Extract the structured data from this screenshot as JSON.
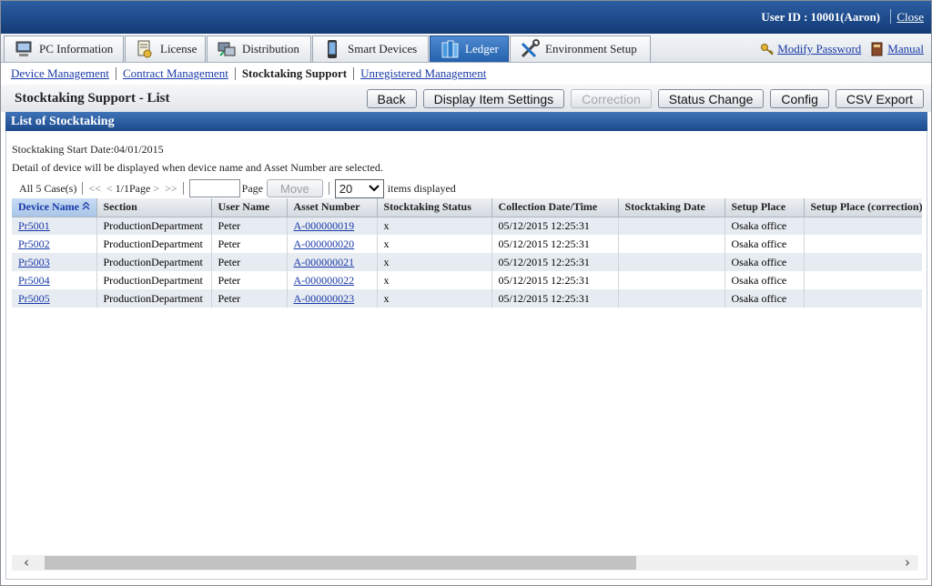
{
  "header": {
    "user_text": "User ID : 10001(Aaron)",
    "close_label": "Close"
  },
  "tabs": [
    {
      "label": "PC Information",
      "icon": "pc-icon"
    },
    {
      "label": "License",
      "icon": "license-icon"
    },
    {
      "label": "Distribution",
      "icon": "distribution-icon"
    },
    {
      "label": "Smart Devices",
      "icon": "smartphone-icon"
    },
    {
      "label": "Ledger",
      "icon": "ledger-icon",
      "active": true
    },
    {
      "label": "Environment Setup",
      "icon": "tools-icon"
    }
  ],
  "links": {
    "modify_password": "Modify Password",
    "manual": "Manual"
  },
  "subnav": {
    "device_management": "Device Management",
    "contract_management": "Contract Management",
    "stocktaking_support": "Stocktaking Support",
    "unregistered_management": "Unregistered Management"
  },
  "page": {
    "title": "Stocktaking Support - List",
    "section_title": "List of Stocktaking"
  },
  "toolbar": {
    "back": "Back",
    "display_item_settings": "Display Item Settings",
    "correction": "Correction",
    "status_change": "Status Change",
    "config": "Config",
    "csv_export": "CSV Export"
  },
  "info": {
    "start_date": "Stocktaking Start Date:04/01/2015",
    "detail_note": "Detail of device will be displayed when device name and Asset Number are selected."
  },
  "paging": {
    "case_count": "All 5 Case(s)",
    "first": "<<",
    "prev": "<",
    "page_indicator": "1/1Page",
    "next": ">",
    "last": ">>",
    "page_input_value": "",
    "page_label": "Page",
    "move_label": "Move",
    "items_per_page": "20",
    "items_label": "items displayed"
  },
  "table": {
    "columns": [
      "Device Name",
      "Section",
      "User Name",
      "Asset Number",
      "Stocktaking Status",
      "Collection Date/Time",
      "Stocktaking Date",
      "Setup Place",
      "Setup Place (correction)"
    ],
    "rows": [
      [
        "Pr5001",
        "ProductionDepartment",
        "Peter",
        "A-000000019",
        "x",
        "05/12/2015 12:25:31",
        "",
        "Osaka office",
        ""
      ],
      [
        "Pr5002",
        "ProductionDepartment",
        "Peter",
        "A-000000020",
        "x",
        "05/12/2015 12:25:31",
        "",
        "Osaka office",
        ""
      ],
      [
        "Pr5003",
        "ProductionDepartment",
        "Peter",
        "A-000000021",
        "x",
        "05/12/2015 12:25:31",
        "",
        "Osaka office",
        ""
      ],
      [
        "Pr5004",
        "ProductionDepartment",
        "Peter",
        "A-000000022",
        "x",
        "05/12/2015 12:25:31",
        "",
        "Osaka office",
        ""
      ],
      [
        "Pr5005",
        "ProductionDepartment",
        "Peter",
        "A-000000023",
        "x",
        "05/12/2015 12:25:31",
        "",
        "Osaka office",
        ""
      ]
    ]
  },
  "colors": {
    "header_blue": "#1d4a8a",
    "link_blue": "#1a3aa8",
    "row_alt": "#e7ecf2"
  }
}
